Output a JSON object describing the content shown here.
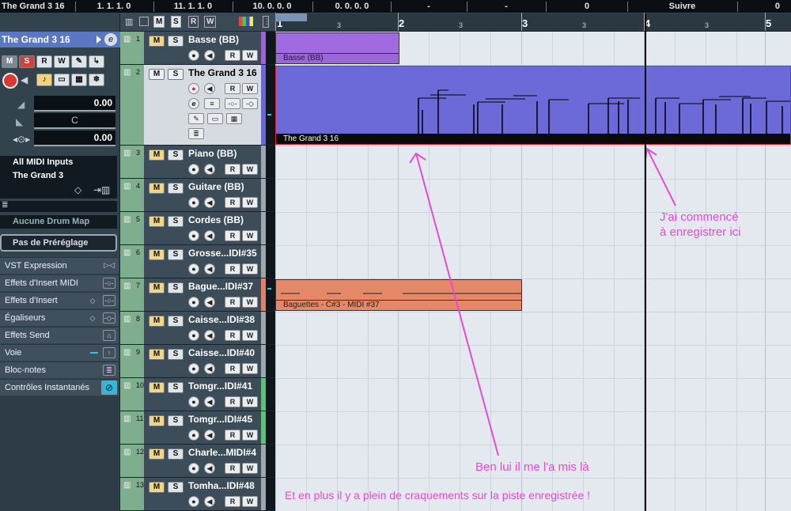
{
  "infoline": {
    "cells": [
      "The Grand 3 16",
      "1. 1. 1. 0",
      "11. 1. 1. 0",
      "10. 0. 0. 0",
      "0. 0. 0. 0",
      "-",
      "-",
      "0",
      "Suivre",
      "0"
    ]
  },
  "inspector": {
    "track_name": "The Grand 3 16",
    "buttons": [
      "M",
      "S",
      "R",
      "W"
    ],
    "volume": "0.00",
    "pan": "C",
    "delay": "0.00",
    "midi_input": "All MIDI Inputs",
    "midi_output": "The Grand 3",
    "drum_map": "Aucune Drum Map",
    "preset": "Pas de Préréglage",
    "sections": [
      "VST Expression",
      "Effets d'Insert MIDI",
      "Effets d'Insert",
      "Égaliseurs",
      "Effets Send",
      "Voie",
      "Bloc-notes",
      "Contrôles Instantanés"
    ]
  },
  "tracks": [
    {
      "num": "1",
      "name": "Basse   (BB)",
      "color": "#9d63d6"
    },
    {
      "num": "2",
      "name": "The Grand 3 16",
      "color": "#6b68d6"
    },
    {
      "num": "3",
      "name": "Piano   (BB)",
      "color": "#9ea7ae"
    },
    {
      "num": "4",
      "name": "Guitare (BB)",
      "color": "#9ea7ae"
    },
    {
      "num": "5",
      "name": "Cordes  (BB)",
      "color": "#9ea7ae"
    },
    {
      "num": "6",
      "name": "Grosse...IDI#35",
      "color": "#9ea7ae"
    },
    {
      "num": "7",
      "name": "Bague...IDI#37",
      "color": "#e2826b"
    },
    {
      "num": "8",
      "name": "Caisse...IDI#38",
      "color": "#9ea7ae"
    },
    {
      "num": "9",
      "name": "Caisse...IDI#40",
      "color": "#9ea7ae"
    },
    {
      "num": "10",
      "name": "Tomgr...IDI#41",
      "color": "#5cc27a"
    },
    {
      "num": "11",
      "name": "Tomgr...IDI#45",
      "color": "#5cc27a"
    },
    {
      "num": "12",
      "name": "Charle...MIDI#4",
      "color": "#9ea7ae"
    },
    {
      "num": "13",
      "name": "Tomha...IDI#48",
      "color": "#9ea7ae"
    }
  ],
  "ruler": {
    "labels": [
      "1",
      "2",
      "3",
      "4",
      "5"
    ],
    "sublabels": [
      "3",
      "3",
      "3",
      "3"
    ]
  },
  "parts": {
    "basse": "Basse   (BB)",
    "grand": "The Grand 3 16",
    "baguettes": "Baguettes - C#3 - MIDI #37"
  },
  "annotations": {
    "started": "J'ai commencé",
    "started2": "à enregistrer ici",
    "placed": "Ben lui il me l'a mis là",
    "crackles": "Et en plus il y a plein de craquements sur la piste enregistrée !"
  },
  "colors": {
    "annotation": "#e44ccf",
    "selected_track": "#5a78c2",
    "recorded_part": "#6b68d6"
  }
}
